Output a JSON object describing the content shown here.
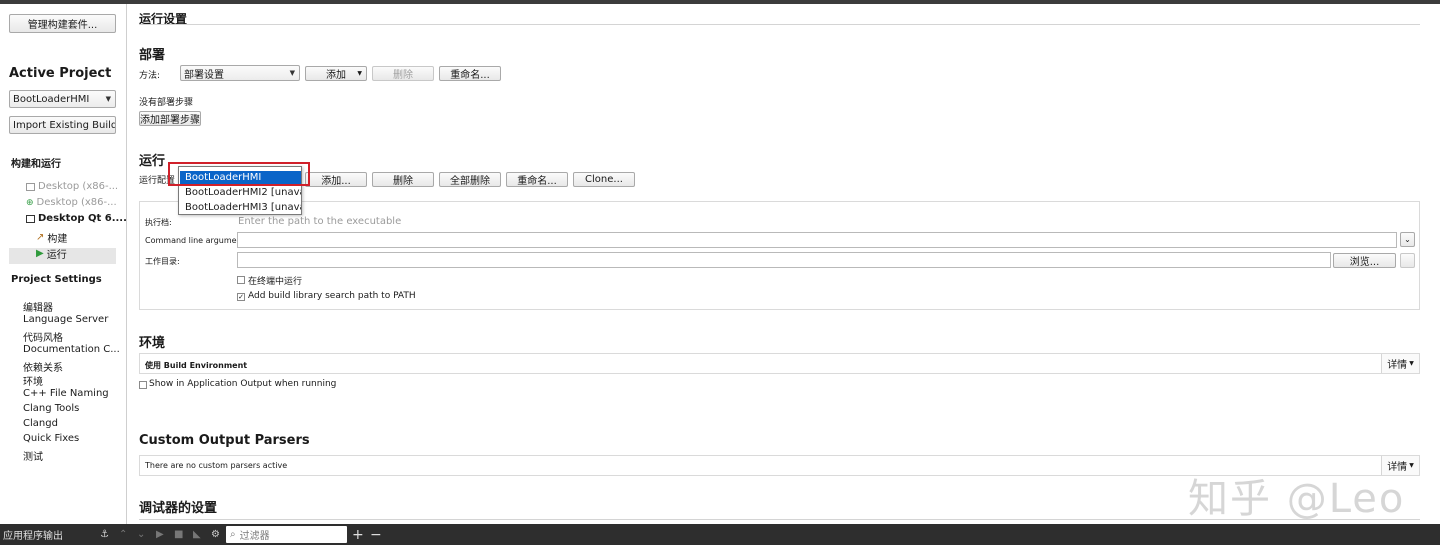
{
  "sidebar": {
    "manage_kits_label": "管理构建套件...",
    "active_project_title": "Active Project",
    "project_select": "BootLoaderHMI",
    "import_button": "Import Existing Build...",
    "build_run_heading": "构建和运行",
    "kits": [
      {
        "label": "Desktop (x86-...",
        "state": "dim"
      },
      {
        "label": "Desktop (x86-...",
        "state": "dim"
      },
      {
        "label": "Desktop Qt 6....",
        "state": "active"
      }
    ],
    "build_label": "构建",
    "run_label": "运行",
    "project_settings_heading": "Project Settings",
    "settings_items": [
      "编辑器",
      "Language Server",
      "代码风格",
      "Documentation C...",
      "依赖关系",
      "环境",
      "C++ File Naming",
      "Clang Tools",
      "Clangd",
      "Quick Fixes",
      "测试"
    ]
  },
  "main": {
    "page_title": "运行设置",
    "deploy": {
      "heading": "部署",
      "method_label": "方法:",
      "method_value": "部署设置",
      "add_label": "添加",
      "delete_label": "删除",
      "rename_label": "重命名...",
      "no_steps_text": "没有部署步骤",
      "add_step_label": "添加部署步骤"
    },
    "run": {
      "heading": "运行",
      "config_label": "运行配置",
      "add_label": "添加...",
      "delete_label": "删除",
      "delete_all_label": "全部删除",
      "rename_label": "重命名...",
      "clone_label": "Clone...",
      "dropdown_options": [
        "BootLoaderHMI",
        "BootLoaderHMI2 [unavailable]",
        "BootLoaderHMI3 [unavailable]"
      ],
      "executable_label": "执行档:",
      "executable_placeholder": "Enter the path to the executable",
      "args_label": "Command line arguments:",
      "workdir_label": "工作目录:",
      "browse_label": "浏览...",
      "run_in_terminal_label": "在终端中运行",
      "add_lib_path_label": "Add build library search path to PATH"
    },
    "environment": {
      "heading": "环境",
      "use_env_label": "使用 Build Environment",
      "details_label": "详情",
      "show_output_label": "Show in Application Output when running"
    },
    "parsers": {
      "heading": "Custom Output Parsers",
      "none_text": "There are no custom parsers active",
      "details_label": "详情"
    },
    "debugger": {
      "heading": "调试器的设置"
    }
  },
  "bottombar": {
    "app_output_label": "应用程序输出",
    "filter_placeholder": "过滤器"
  },
  "watermark": "知乎 @Leo",
  "colors": {
    "selection": "#0a64c8",
    "highlight_border": "#d0202a",
    "bottombar": "#2e2e2e"
  }
}
